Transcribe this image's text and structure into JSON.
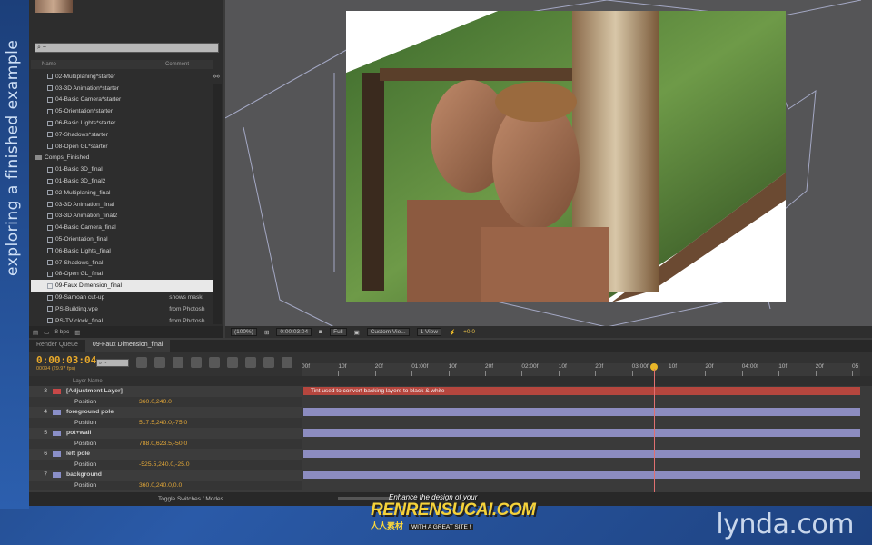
{
  "side_caption": "exploring a finished example",
  "project": {
    "search_placeholder": "⌕ ~",
    "col_name": "Name",
    "col_comment": "Comment",
    "items": [
      {
        "name": "02-Multiplaning*starter",
        "comment": "",
        "type": "comp"
      },
      {
        "name": "03-3D Animation*starter",
        "comment": "",
        "type": "comp"
      },
      {
        "name": "04-Basic Camera*starter",
        "comment": "",
        "type": "comp"
      },
      {
        "name": "05-Orientation*starter",
        "comment": "",
        "type": "comp"
      },
      {
        "name": "06-Basic Lights*starter",
        "comment": "",
        "type": "comp"
      },
      {
        "name": "07-Shadows*starter",
        "comment": "",
        "type": "comp"
      },
      {
        "name": "08-Open GL*starter",
        "comment": "",
        "type": "comp"
      },
      {
        "name": "Comps_Finished",
        "comment": "",
        "type": "folder"
      },
      {
        "name": "01-Basic 3D_final",
        "comment": "",
        "type": "comp"
      },
      {
        "name": "01-Basic 3D_final2",
        "comment": "",
        "type": "comp"
      },
      {
        "name": "02-Multiplaning_final",
        "comment": "",
        "type": "comp"
      },
      {
        "name": "03-3D Animation_final",
        "comment": "",
        "type": "comp"
      },
      {
        "name": "03-3D Animation_final2",
        "comment": "",
        "type": "comp"
      },
      {
        "name": "04-Basic Camera_final",
        "comment": "",
        "type": "comp"
      },
      {
        "name": "05-Orientation_final",
        "comment": "",
        "type": "comp"
      },
      {
        "name": "06-Basic Lights_final",
        "comment": "",
        "type": "comp"
      },
      {
        "name": "07-Shadows_final",
        "comment": "",
        "type": "comp"
      },
      {
        "name": "08-Open GL_final",
        "comment": "",
        "type": "comp"
      },
      {
        "name": "09-Faux Dimension_final",
        "comment": "",
        "type": "comp",
        "selected": true
      },
      {
        "name": "09-Samoan cut-up",
        "comment": "shows maski",
        "type": "comp"
      },
      {
        "name": "PS-Building.vpe",
        "comment": "from Photosh",
        "type": "comp"
      },
      {
        "name": "PS-TV clock_final",
        "comment": "from Photosh",
        "type": "comp"
      }
    ],
    "footer_bpc": "8 bpc"
  },
  "viewer_bar": {
    "zoom": "(100%)",
    "timecode": "0:00:03:04",
    "resolution": "Full",
    "view": "Custom Vie...",
    "views": "1 View",
    "exposure": "+0.0"
  },
  "timeline": {
    "tab_render_queue": "Render Queue",
    "tab_comp": "09-Faux Dimension_final",
    "timecode": "0:00:03:04",
    "fps": "00094 (29.97 fps)",
    "search_placeholder": "⌕ ~",
    "col_layer_name": "Layer Name",
    "ruler": [
      "00f",
      "10f",
      "20f",
      "01:00f",
      "10f",
      "20f",
      "02:00f",
      "10f",
      "20f",
      "03:00f",
      "10f",
      "20f",
      "04:00f",
      "10f",
      "20f",
      "05"
    ],
    "layers": [
      {
        "num": "3",
        "name": "[Adjustment Layer]",
        "prop": "Position",
        "value": "360.0,240.0",
        "label": "red",
        "bar_text": "Tint used to convert backing layers to black & white"
      },
      {
        "num": "4",
        "name": "foreground pole",
        "prop": "Position",
        "value": "517.5,240.0,-75.0",
        "label": "blue",
        "bar_text": ""
      },
      {
        "num": "5",
        "name": "pot+wall",
        "prop": "Position",
        "value": "788.0,623.5,-50.0",
        "label": "blue",
        "bar_text": ""
      },
      {
        "num": "6",
        "name": "left pole",
        "prop": "Position",
        "value": "-525.5,240.0,-25.0",
        "label": "blue",
        "bar_text": ""
      },
      {
        "num": "7",
        "name": "background",
        "prop": "Position",
        "value": "360.0,240.0,0.0",
        "label": "blue",
        "bar_text": ""
      }
    ],
    "toggle_label": "Toggle Switches / Modes"
  },
  "branding": {
    "lynda": "lynda.com",
    "wm_top": "Enhance the design of your",
    "wm_main": "RENRENSUCAI.COM",
    "wm_cn": "人人素材",
    "wm_sub": "WITH A GREAT SITE !"
  },
  "colors": {
    "timecode": "#e8a92a",
    "layer_bar": "#8c8cc0",
    "adjustment_bar": "#b5463e"
  }
}
